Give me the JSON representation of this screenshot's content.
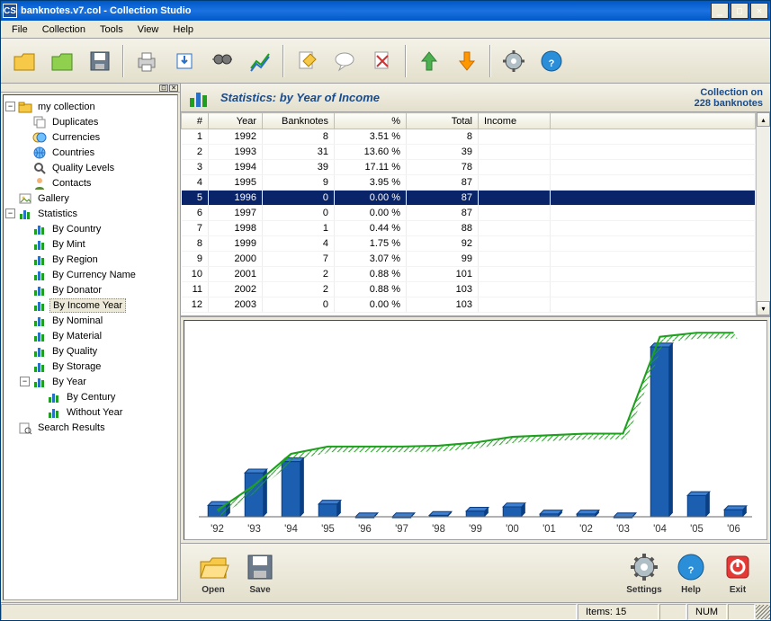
{
  "window": {
    "title": "banknotes.v7.col - Collection Studio",
    "app_abbrev": "CS"
  },
  "menu": {
    "items": [
      "File",
      "Collection",
      "Tools",
      "View",
      "Help"
    ]
  },
  "toolbar_icons": [
    "folder",
    "newfolder",
    "save",
    "print",
    "export",
    "binoculars",
    "chart",
    "edit",
    "comment",
    "clear",
    "uparrow",
    "downarrow",
    "gear",
    "help"
  ],
  "tree": {
    "root": "my collection",
    "children1": [
      "Duplicates",
      "Currencies",
      "Countries",
      "Quality Levels",
      "Contacts"
    ],
    "gallery": "Gallery",
    "stats": "Statistics",
    "stats_children": [
      "By Country",
      "By Mint",
      "By Region",
      "By Currency Name",
      "By Donator",
      "By Income Year",
      "By Nominal",
      "By Material",
      "By Quality",
      "By Storage",
      "By Year"
    ],
    "byyear_children": [
      "By Century",
      "Without Year"
    ],
    "search": "Search Results",
    "selected": "By Income Year"
  },
  "stats_header": {
    "title": "Statistics: by Year of Income",
    "right1": "Collection on",
    "right2": "228 banknotes"
  },
  "table": {
    "columns": [
      "#",
      "Year",
      "Banknotes",
      "%",
      "Total",
      "Income"
    ],
    "rows": [
      {
        "n": 1,
        "year": 1992,
        "bank": 8,
        "pct": "3.51 %",
        "total": 8,
        "inc": ""
      },
      {
        "n": 2,
        "year": 1993,
        "bank": 31,
        "pct": "13.60 %",
        "total": 39,
        "inc": ""
      },
      {
        "n": 3,
        "year": 1994,
        "bank": 39,
        "pct": "17.11 %",
        "total": 78,
        "inc": ""
      },
      {
        "n": 4,
        "year": 1995,
        "bank": 9,
        "pct": "3.95 %",
        "total": 87,
        "inc": ""
      },
      {
        "n": 5,
        "year": 1996,
        "bank": 0,
        "pct": "0.00 %",
        "total": 87,
        "inc": "",
        "sel": true
      },
      {
        "n": 6,
        "year": 1997,
        "bank": 0,
        "pct": "0.00 %",
        "total": 87,
        "inc": ""
      },
      {
        "n": 7,
        "year": 1998,
        "bank": 1,
        "pct": "0.44 %",
        "total": 88,
        "inc": ""
      },
      {
        "n": 8,
        "year": 1999,
        "bank": 4,
        "pct": "1.75 %",
        "total": 92,
        "inc": ""
      },
      {
        "n": 9,
        "year": 2000,
        "bank": 7,
        "pct": "3.07 %",
        "total": 99,
        "inc": ""
      },
      {
        "n": 10,
        "year": 2001,
        "bank": 2,
        "pct": "0.88 %",
        "total": 101,
        "inc": ""
      },
      {
        "n": 11,
        "year": 2002,
        "bank": 2,
        "pct": "0.88 %",
        "total": 103,
        "inc": ""
      },
      {
        "n": 12,
        "year": 2003,
        "bank": 0,
        "pct": "0.00 %",
        "total": 103,
        "inc": ""
      }
    ]
  },
  "chart_data": {
    "type": "bar",
    "categories": [
      "'92",
      "'93",
      "'94",
      "'95",
      "'96",
      "'97",
      "'98",
      "'99",
      "'00",
      "'01",
      "'02",
      "'03",
      "'04",
      "'05",
      "'06"
    ],
    "series": [
      {
        "name": "Banknotes",
        "type": "bar",
        "values": [
          8,
          31,
          39,
          9,
          0,
          0,
          1,
          4,
          7,
          2,
          2,
          0,
          120,
          15,
          5
        ]
      },
      {
        "name": "Total",
        "type": "line",
        "values": [
          8,
          39,
          78,
          87,
          87,
          87,
          88,
          92,
          99,
          101,
          103,
          103,
          223,
          228,
          228
        ]
      }
    ],
    "ylim": [
      0,
      130
    ],
    "title": "",
    "xlabel": "",
    "ylabel": ""
  },
  "bottombar": {
    "open": "Open",
    "save": "Save",
    "settings": "Settings",
    "help": "Help",
    "exit": "Exit"
  },
  "statusbar": {
    "items": "Items: 15",
    "num": "NUM"
  }
}
